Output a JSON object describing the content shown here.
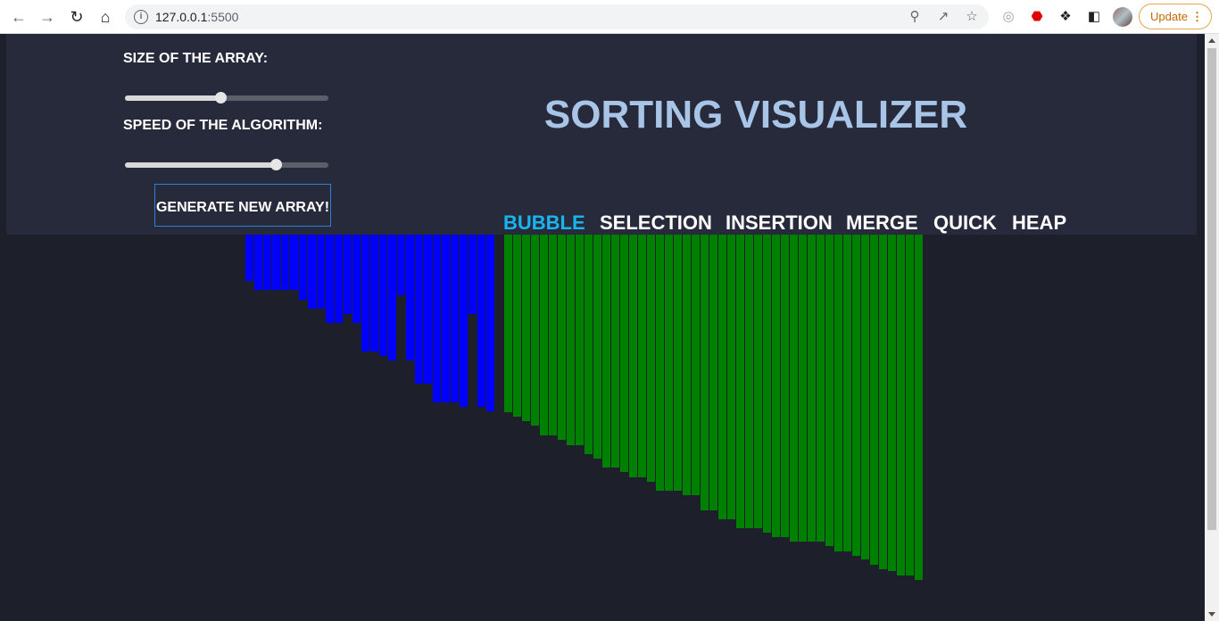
{
  "browser": {
    "url_host": "127.0.0.1",
    "url_port": ":5500",
    "update_label": "Update"
  },
  "controls": {
    "size_label": "SIZE OF THE ARRAY:",
    "size_value": 0.47,
    "speed_label": "SPEED OF THE ALGORITHM:",
    "speed_value": 0.74,
    "generate_label": "GENERATE NEW ARRAY!"
  },
  "title": "SORTING VISUALIZER",
  "algorithms": [
    {
      "label": "BUBBLE",
      "active": true
    },
    {
      "label": "SELECTION",
      "active": false
    },
    {
      "label": "INSERTION",
      "active": false
    },
    {
      "label": "MERGE",
      "active": false
    },
    {
      "label": "QUICK",
      "active": false
    },
    {
      "label": "HEAP",
      "active": false
    }
  ],
  "colors": {
    "unsorted": "#0000ff",
    "sorted": "#008000",
    "active_algo": "#1ab4ef"
  },
  "array": {
    "unsorted_heights": [
      52,
      62,
      62,
      62,
      62,
      62,
      73,
      83,
      83,
      99,
      99,
      89,
      99,
      131,
      131,
      136,
      141,
      68,
      141,
      167,
      167,
      188,
      188,
      188,
      193,
      89,
      193,
      198,
      0
    ],
    "sorted_heights": [
      199,
      204,
      209,
      214,
      225,
      225,
      230,
      236,
      236,
      246,
      251,
      261,
      261,
      266,
      272,
      272,
      277,
      287,
      287,
      287,
      292,
      292,
      309,
      309,
      319,
      319,
      329,
      329,
      329,
      334,
      339,
      339,
      344,
      344,
      344,
      344,
      349,
      355,
      355,
      360,
      364,
      370,
      375,
      377,
      382,
      382,
      387
    ]
  }
}
